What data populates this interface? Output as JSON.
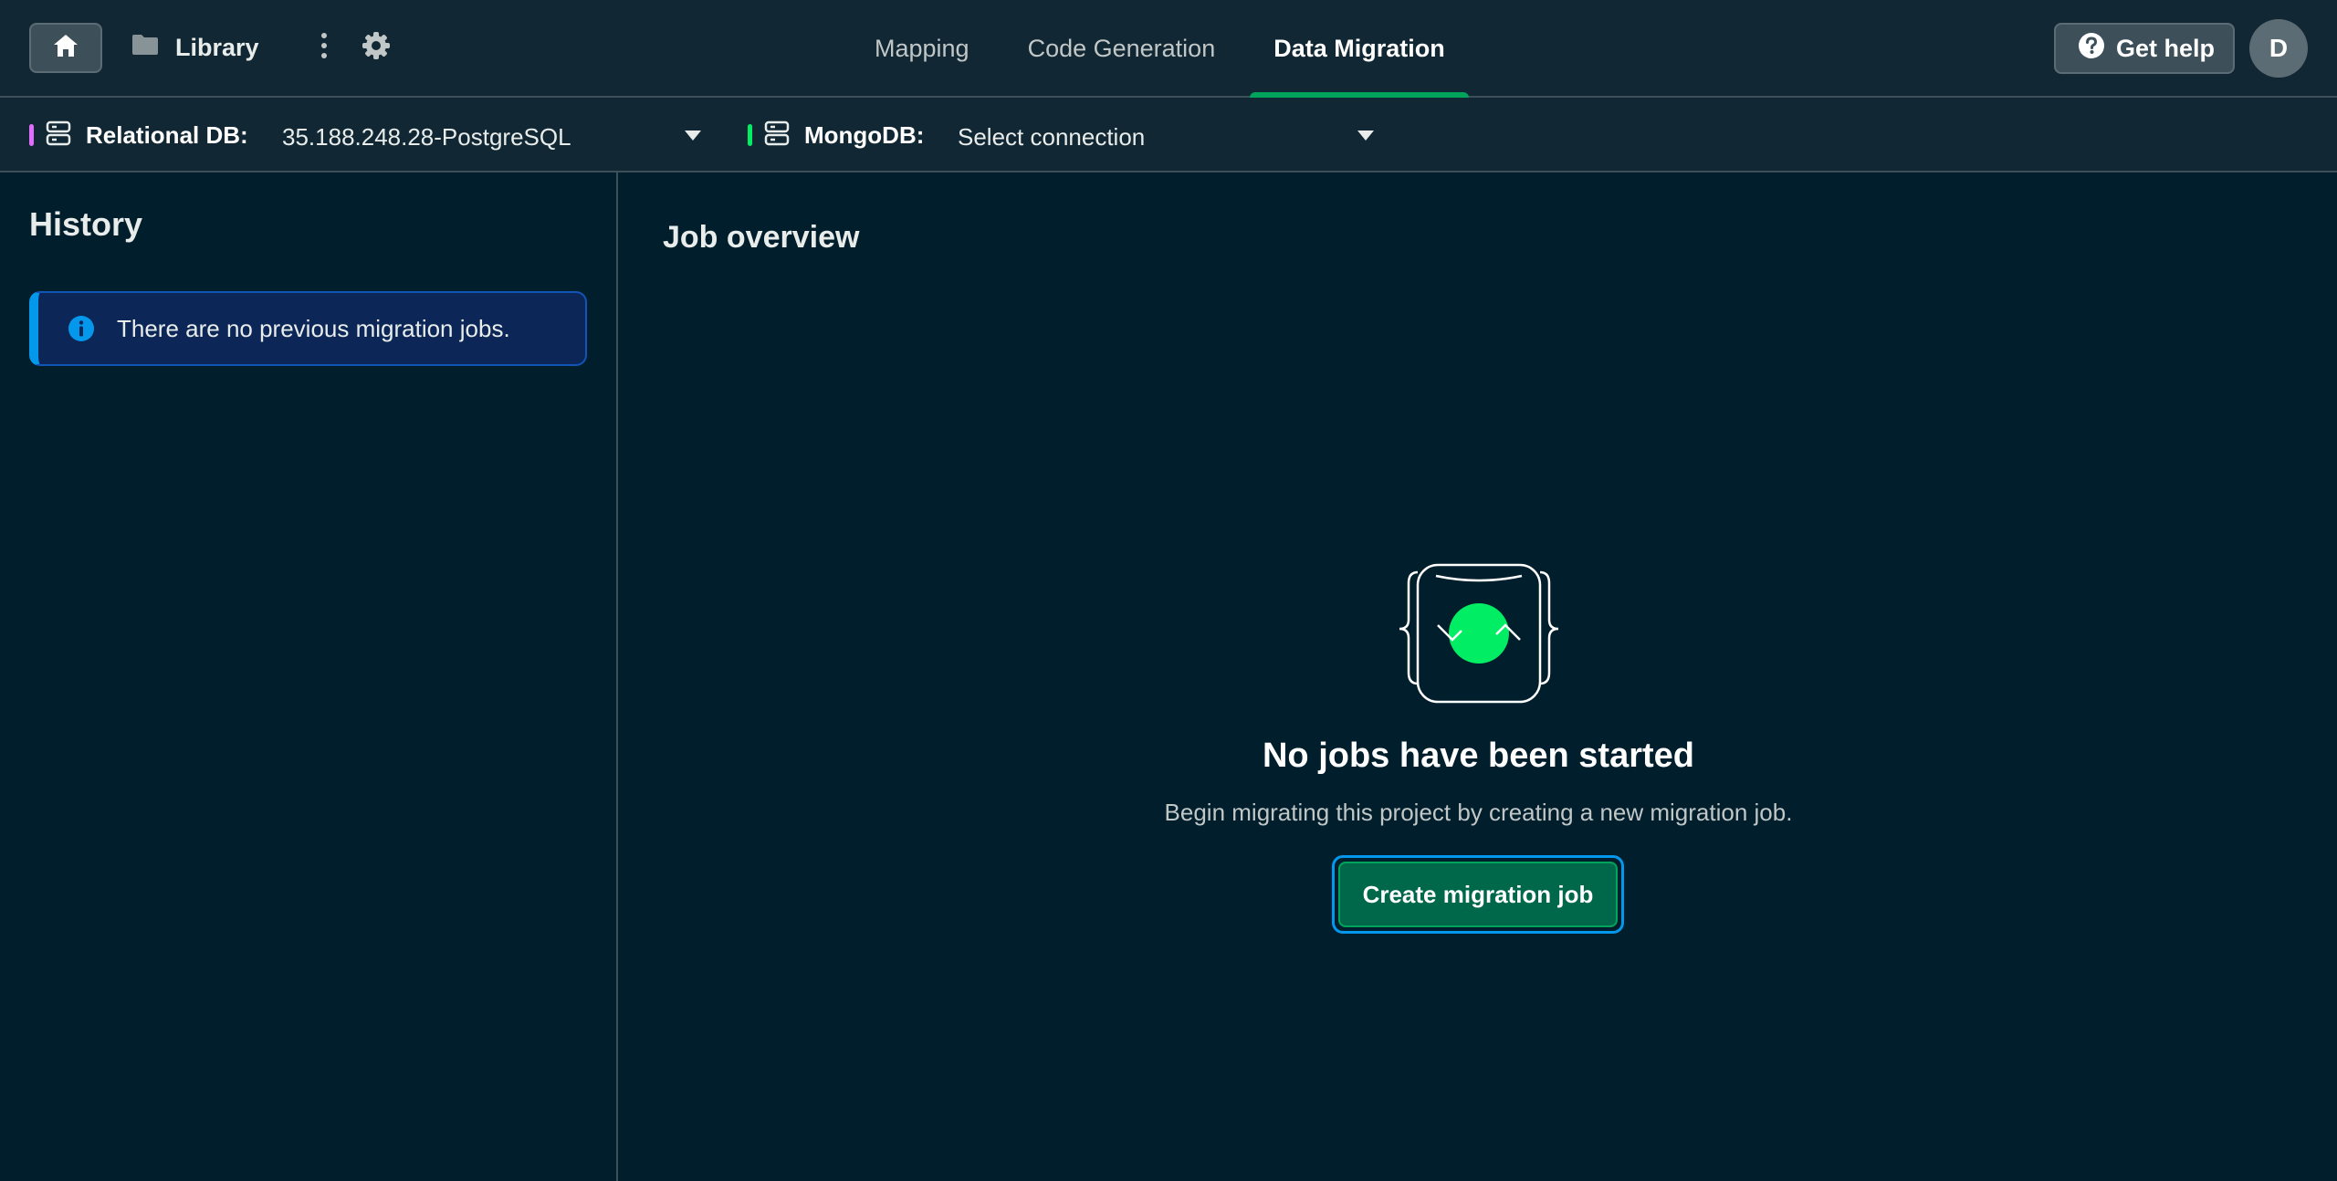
{
  "topbar": {
    "library_label": "Library",
    "tabs": [
      {
        "label": "Mapping",
        "active": false
      },
      {
        "label": "Code Generation",
        "active": false
      },
      {
        "label": "Data Migration",
        "active": true
      }
    ],
    "help_label": "Get help",
    "avatar_initial": "D"
  },
  "connections": {
    "relational": {
      "label": "Relational DB:",
      "value": "35.188.248.28-PostgreSQL",
      "accent_color": "#e06dff"
    },
    "mongodb": {
      "label": "MongoDB:",
      "value": "Select connection",
      "accent_color": "#00ed64"
    }
  },
  "sidebar": {
    "title": "History",
    "info_message": "There are no previous migration jobs."
  },
  "main": {
    "title": "Job overview",
    "empty_state": {
      "title": "No jobs have been started",
      "description": "Begin migrating this project by creating a new migration job.",
      "button_label": "Create migration job"
    }
  },
  "icons": {
    "home": "home-icon",
    "folder": "folder-icon",
    "kebab": "kebab-icon",
    "gear": "gear-icon",
    "help": "question-circle-icon",
    "database": "database-icon",
    "caret": "caret-down-icon",
    "info": "info-icon"
  },
  "colors": {
    "background": "#001e2b",
    "header": "#112733",
    "accent_green": "#00a35c",
    "primary_button": "#00684a",
    "info_blue": "#0498ec"
  }
}
